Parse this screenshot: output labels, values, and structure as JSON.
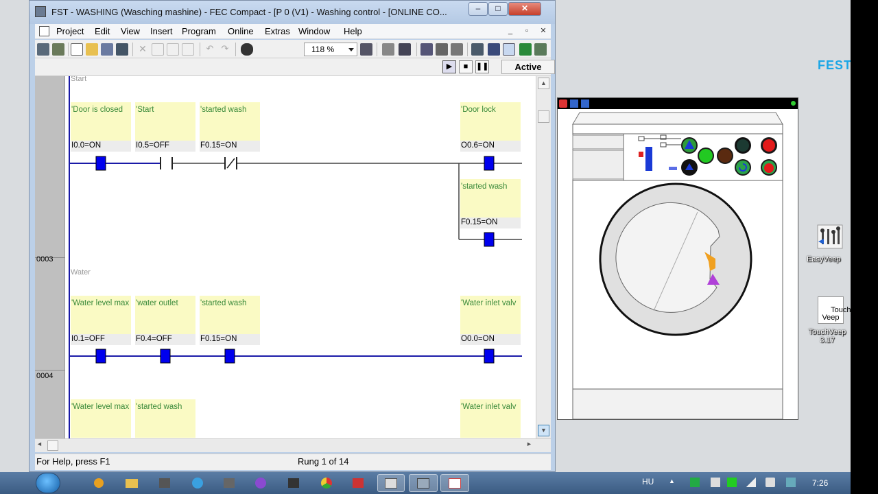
{
  "window": {
    "title": "FST - WASHING (Wasching mashine) - FEC Compact - [P  0 (V1) - Washing control - [ONLINE CO..."
  },
  "menu": [
    "Project",
    "Edit",
    "View",
    "Insert",
    "Program",
    "Online",
    "Extras",
    "Window",
    "Help"
  ],
  "toolbar": {
    "zoom": "118 %"
  },
  "plc_state": {
    "status": "Active"
  },
  "editor": {
    "rung_numbers": [
      "0003",
      "0004"
    ],
    "rungs": [
      {
        "title": "Start",
        "contacts": [
          {
            "comment": "'Door is closed",
            "address": "I0.0=ON"
          },
          {
            "comment": "'Start",
            "address": "I0.5=OFF"
          },
          {
            "comment": "'started wash",
            "address": "F0.15=ON"
          }
        ],
        "coils": [
          {
            "comment": "'Door lock",
            "address": "O0.6=ON"
          },
          {
            "comment": "'started wash",
            "address": "F0.15=ON"
          }
        ]
      },
      {
        "title": "Water",
        "contacts": [
          {
            "comment": "'Water level max",
            "address": "I0.1=OFF"
          },
          {
            "comment": "'water outlet",
            "address": "F0.4=OFF"
          },
          {
            "comment": "'started wash",
            "address": "F0.15=ON"
          }
        ],
        "coils": [
          {
            "comment": "'Water inlet valv",
            "address": "O0.0=ON"
          }
        ]
      },
      {
        "title": "",
        "contacts": [
          {
            "comment": "'Water level max"
          },
          {
            "comment": "'started wash"
          }
        ],
        "coils": [
          {
            "comment": "'Water inlet valv"
          }
        ]
      }
    ]
  },
  "status_bar": {
    "help": "For Help, press F1",
    "rung": "Rung 1 of 14"
  },
  "desktop": {
    "festo_logo": "FEST",
    "icons": [
      {
        "label": "EasyVeep"
      },
      {
        "label": "TouchVeep\n3.17",
        "badge": "Touch\nVeep"
      }
    ]
  },
  "taskbar": {
    "language": "HU",
    "time": "7:26"
  },
  "colors": {
    "contact_comment": "#3a8a3a",
    "comment_box": "#fafac4",
    "ladder_active": "#1a1aa8",
    "contact_block": "#0000ee",
    "taskbar": "#3b5b82"
  }
}
